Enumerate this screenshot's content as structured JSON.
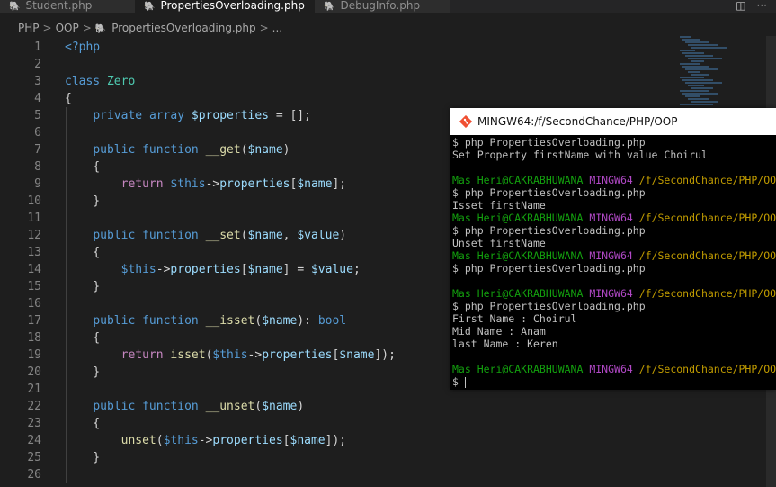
{
  "tabs": [
    {
      "label": "Student.php",
      "active": false,
      "icon": "php-elephant-icon"
    },
    {
      "label": "PropertiesOverloading.php",
      "active": true,
      "icon": "php-elephant-icon"
    },
    {
      "label": "DebugInfo.php",
      "active": false,
      "icon": "php-elephant-icon"
    }
  ],
  "tab_icons": [
    "split-editor-icon",
    "more-actions-icon"
  ],
  "breadcrumb": {
    "parts": [
      "PHP",
      "OOP",
      "PropertiesOverloading.php",
      "..."
    ],
    "separator": ">"
  },
  "editor": {
    "colors": {
      "background": "#1e1e1e",
      "keyword": "#569cd6",
      "type": "#4ec9b0",
      "variable": "#9cdcfe",
      "function": "#dcdcaa",
      "control": "#c586c0"
    },
    "lines": [
      {
        "num": "1",
        "tokens": [
          {
            "t": "<?php",
            "c": "tag"
          }
        ]
      },
      {
        "num": "2",
        "tokens": []
      },
      {
        "num": "3",
        "tokens": [
          {
            "t": "class ",
            "c": "kw"
          },
          {
            "t": "Zero",
            "c": "ty"
          }
        ]
      },
      {
        "num": "4",
        "tokens": [
          {
            "t": "{",
            "c": "p"
          }
        ]
      },
      {
        "num": "5",
        "tokens": [
          {
            "t": "    "
          },
          {
            "t": "private ",
            "c": "kw"
          },
          {
            "t": "array ",
            "c": "kw"
          },
          {
            "t": "$properties",
            "c": "var"
          },
          {
            "t": " = [];",
            "c": "p"
          }
        ]
      },
      {
        "num": "6",
        "tokens": []
      },
      {
        "num": "7",
        "tokens": [
          {
            "t": "    "
          },
          {
            "t": "public ",
            "c": "kw"
          },
          {
            "t": "function ",
            "c": "kw"
          },
          {
            "t": "__get",
            "c": "fn"
          },
          {
            "t": "(",
            "c": "p"
          },
          {
            "t": "$name",
            "c": "var"
          },
          {
            "t": ")",
            "c": "p"
          }
        ]
      },
      {
        "num": "8",
        "tokens": [
          {
            "t": "    {",
            "c": "p"
          }
        ]
      },
      {
        "num": "9",
        "tokens": [
          {
            "t": "        "
          },
          {
            "t": "return ",
            "c": "ctl"
          },
          {
            "t": "$this",
            "c": "kw"
          },
          {
            "t": "->",
            "c": "p"
          },
          {
            "t": "properties",
            "c": "var"
          },
          {
            "t": "[",
            "c": "p"
          },
          {
            "t": "$name",
            "c": "var"
          },
          {
            "t": "];",
            "c": "p"
          }
        ]
      },
      {
        "num": "10",
        "tokens": [
          {
            "t": "    }",
            "c": "p"
          }
        ]
      },
      {
        "num": "11",
        "tokens": []
      },
      {
        "num": "12",
        "tokens": [
          {
            "t": "    "
          },
          {
            "t": "public ",
            "c": "kw"
          },
          {
            "t": "function ",
            "c": "kw"
          },
          {
            "t": "__set",
            "c": "fn"
          },
          {
            "t": "(",
            "c": "p"
          },
          {
            "t": "$name",
            "c": "var"
          },
          {
            "t": ", ",
            "c": "p"
          },
          {
            "t": "$value",
            "c": "var"
          },
          {
            "t": ")",
            "c": "p"
          }
        ]
      },
      {
        "num": "13",
        "tokens": [
          {
            "t": "    {",
            "c": "p"
          }
        ]
      },
      {
        "num": "14",
        "tokens": [
          {
            "t": "        "
          },
          {
            "t": "$this",
            "c": "kw"
          },
          {
            "t": "->",
            "c": "p"
          },
          {
            "t": "properties",
            "c": "var"
          },
          {
            "t": "[",
            "c": "p"
          },
          {
            "t": "$name",
            "c": "var"
          },
          {
            "t": "] = ",
            "c": "p"
          },
          {
            "t": "$value",
            "c": "var"
          },
          {
            "t": ";",
            "c": "p"
          }
        ]
      },
      {
        "num": "15",
        "tokens": [
          {
            "t": "    }",
            "c": "p"
          }
        ]
      },
      {
        "num": "16",
        "tokens": []
      },
      {
        "num": "17",
        "tokens": [
          {
            "t": "    "
          },
          {
            "t": "public ",
            "c": "kw"
          },
          {
            "t": "function ",
            "c": "kw"
          },
          {
            "t": "__isset",
            "c": "fn"
          },
          {
            "t": "(",
            "c": "p"
          },
          {
            "t": "$name",
            "c": "var"
          },
          {
            "t": "): ",
            "c": "p"
          },
          {
            "t": "bool",
            "c": "kw"
          }
        ]
      },
      {
        "num": "18",
        "tokens": [
          {
            "t": "    {",
            "c": "p"
          }
        ]
      },
      {
        "num": "19",
        "tokens": [
          {
            "t": "        "
          },
          {
            "t": "return ",
            "c": "ctl"
          },
          {
            "t": "isset",
            "c": "fn"
          },
          {
            "t": "(",
            "c": "p"
          },
          {
            "t": "$this",
            "c": "kw"
          },
          {
            "t": "->",
            "c": "p"
          },
          {
            "t": "properties",
            "c": "var"
          },
          {
            "t": "[",
            "c": "p"
          },
          {
            "t": "$name",
            "c": "var"
          },
          {
            "t": "]);",
            "c": "p"
          }
        ]
      },
      {
        "num": "20",
        "tokens": [
          {
            "t": "    }",
            "c": "p"
          }
        ]
      },
      {
        "num": "21",
        "tokens": []
      },
      {
        "num": "22",
        "tokens": [
          {
            "t": "    "
          },
          {
            "t": "public ",
            "c": "kw"
          },
          {
            "t": "function ",
            "c": "kw"
          },
          {
            "t": "__unset",
            "c": "fn"
          },
          {
            "t": "(",
            "c": "p"
          },
          {
            "t": "$name",
            "c": "var"
          },
          {
            "t": ")",
            "c": "p"
          }
        ]
      },
      {
        "num": "23",
        "tokens": [
          {
            "t": "    {",
            "c": "p"
          }
        ]
      },
      {
        "num": "24",
        "tokens": [
          {
            "t": "        "
          },
          {
            "t": "unset",
            "c": "fn"
          },
          {
            "t": "(",
            "c": "p"
          },
          {
            "t": "$this",
            "c": "kw"
          },
          {
            "t": "->",
            "c": "p"
          },
          {
            "t": "properties",
            "c": "var"
          },
          {
            "t": "[",
            "c": "p"
          },
          {
            "t": "$name",
            "c": "var"
          },
          {
            "t": "]);",
            "c": "p"
          }
        ]
      },
      {
        "num": "25",
        "tokens": [
          {
            "t": "    }",
            "c": "p"
          }
        ]
      },
      {
        "num": "26",
        "tokens": []
      }
    ]
  },
  "terminal": {
    "title": "MINGW64:/f/SecondChance/PHP/OOP",
    "icon": "git-bash-icon",
    "colors": {
      "background": "#000000",
      "user": "#13a10e",
      "mingw": "#b148c6",
      "path": "#c19c00",
      "text": "#c0c0c0"
    },
    "lines": [
      {
        "type": "out",
        "text": "$ php PropertiesOverloading.php"
      },
      {
        "type": "out",
        "text": "Set Property firstName with value Choirul"
      },
      {
        "type": "blank"
      },
      {
        "type": "prompt",
        "user": "Mas Heri@CAKRABHUWANA",
        "env": "MINGW64",
        "path": "/f/SecondChance/PHP/OOP"
      },
      {
        "type": "out",
        "text": "$ php PropertiesOverloading.php"
      },
      {
        "type": "out",
        "text": "Isset firstName"
      },
      {
        "type": "prompt",
        "user": "Mas Heri@CAKRABHUWANA",
        "env": "MINGW64",
        "path": "/f/SecondChance/PHP/OOP"
      },
      {
        "type": "out",
        "text": "$ php PropertiesOverloading.php"
      },
      {
        "type": "out",
        "text": "Unset firstName"
      },
      {
        "type": "prompt",
        "user": "Mas Heri@CAKRABHUWANA",
        "env": "MINGW64",
        "path": "/f/SecondChance/PHP/OOP"
      },
      {
        "type": "out",
        "text": "$ php PropertiesOverloading.php"
      },
      {
        "type": "blank"
      },
      {
        "type": "prompt",
        "user": "Mas Heri@CAKRABHUWANA",
        "env": "MINGW64",
        "path": "/f/SecondChance/PHP/OOP"
      },
      {
        "type": "out",
        "text": "$ php PropertiesOverloading.php"
      },
      {
        "type": "out",
        "text": "First Name : Choirul"
      },
      {
        "type": "out",
        "text": "Mid Name : Anam"
      },
      {
        "type": "out",
        "text": "last Name : Keren"
      },
      {
        "type": "blank"
      },
      {
        "type": "prompt",
        "user": "Mas Heri@CAKRABHUWANA",
        "env": "MINGW64",
        "path": "/f/SecondChance/PHP/OOP"
      },
      {
        "type": "input",
        "text": "$ "
      }
    ]
  }
}
